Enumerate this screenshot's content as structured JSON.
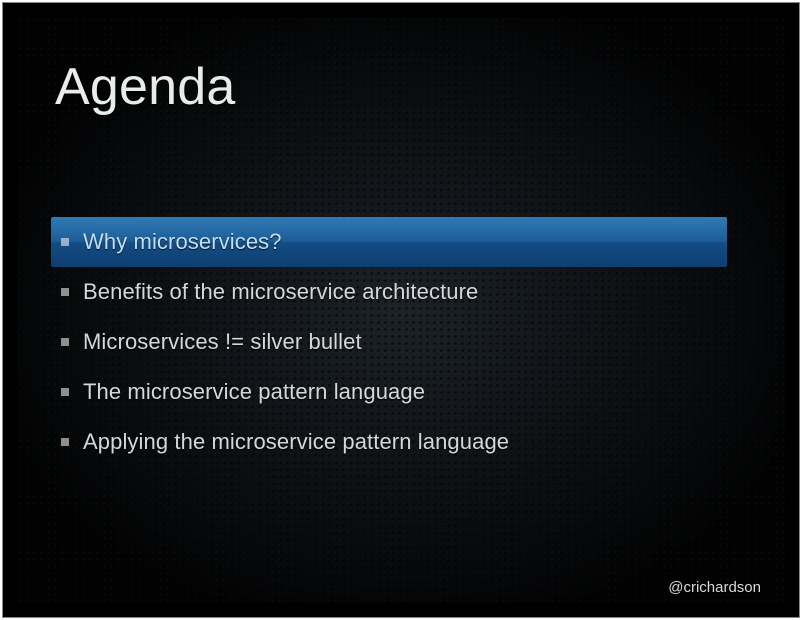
{
  "slide": {
    "title": "Agenda",
    "items": [
      {
        "label": "Why microservices?",
        "highlight": true
      },
      {
        "label": "Benefits of the microservice architecture",
        "highlight": false
      },
      {
        "label": "Microservices != silver bullet",
        "highlight": false
      },
      {
        "label": "The microservice pattern language",
        "highlight": false
      },
      {
        "label": "Applying the microservice pattern language",
        "highlight": false
      }
    ],
    "footer": "@crichardson"
  }
}
